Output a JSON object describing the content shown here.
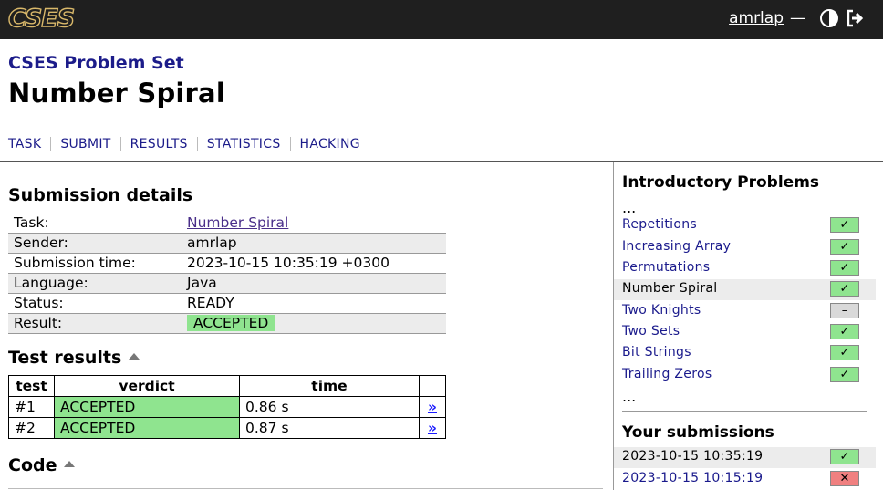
{
  "topbar": {
    "logo_text": "CSES",
    "username": "amrlap",
    "dash": "—"
  },
  "header": {
    "set_title": "CSES Problem Set",
    "problem_title": "Number Spiral"
  },
  "nav": [
    "TASK",
    "SUBMIT",
    "RESULTS",
    "STATISTICS",
    "HACKING"
  ],
  "submission": {
    "heading": "Submission details",
    "rows": [
      {
        "key": "Task:",
        "value": "Number Spiral"
      },
      {
        "key": "Sender:",
        "value": "amrlap"
      },
      {
        "key": "Submission time:",
        "value": "2023-10-15 10:35:19 +0300"
      },
      {
        "key": "Language:",
        "value": "Java"
      },
      {
        "key": "Status:",
        "value": "READY"
      },
      {
        "key": "Result:",
        "value": "ACCEPTED"
      }
    ]
  },
  "tests": {
    "heading": "Test results",
    "columns": [
      "test",
      "verdict",
      "time"
    ],
    "rows": [
      {
        "test": "#1",
        "verdict": "ACCEPTED",
        "time": "0.86 s",
        "link": "»"
      },
      {
        "test": "#2",
        "verdict": "ACCEPTED",
        "time": "0.87 s",
        "link": "»"
      }
    ]
  },
  "code": {
    "heading": "Code"
  },
  "sidebar": {
    "section_title": "Introductory Problems",
    "ellipsis": "...",
    "problems": [
      {
        "name": "Repetitions",
        "status": "✓"
      },
      {
        "name": "Increasing Array",
        "status": "✓"
      },
      {
        "name": "Permutations",
        "status": "✓"
      },
      {
        "name": "Number Spiral",
        "status": "✓"
      },
      {
        "name": "Two Knights",
        "status": "–"
      },
      {
        "name": "Two Sets",
        "status": "✓"
      },
      {
        "name": "Bit Strings",
        "status": "✓"
      },
      {
        "name": "Trailing Zeros",
        "status": "✓"
      }
    ],
    "submissions_title": "Your submissions",
    "submissions": [
      {
        "time": "2023-10-15 10:35:19",
        "status": "✓"
      },
      {
        "time": "2023-10-15 10:15:19",
        "status": "✕"
      }
    ]
  },
  "colors": {
    "accepted": "#8fe48f",
    "rejected": "#f08080",
    "link": "#1c1c8a",
    "topbar": "#1f1f1f"
  }
}
